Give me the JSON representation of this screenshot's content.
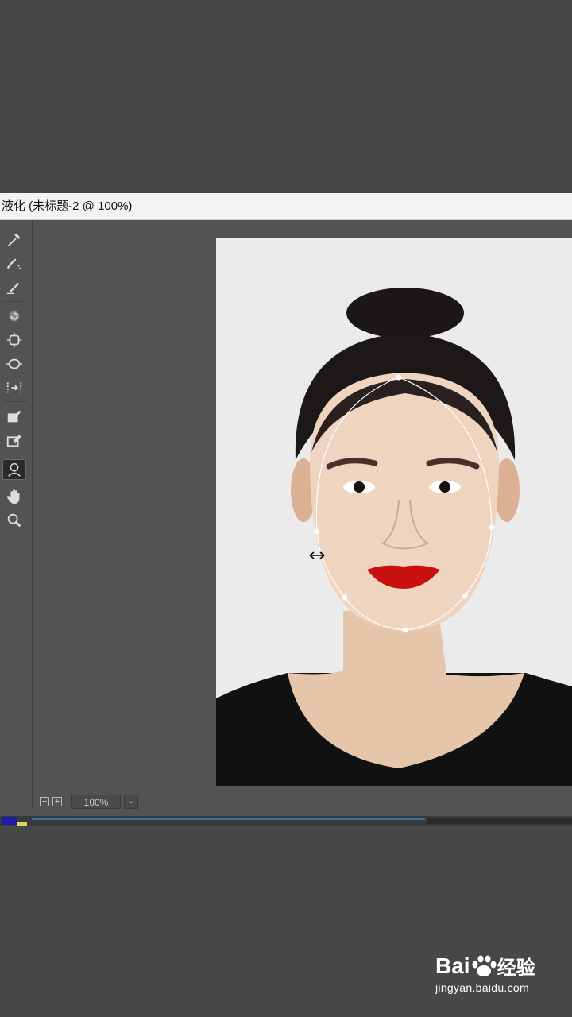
{
  "window": {
    "title": "液化 (未标题-2 @ 100%)"
  },
  "toolbar": {
    "tools": [
      {
        "name": "forward-warp-tool",
        "icon": "warp-icon"
      },
      {
        "name": "reconstruct-tool",
        "icon": "reconstruct-icon"
      },
      {
        "name": "smooth-tool",
        "icon": "smooth-icon"
      },
      {
        "name": "twirl-tool",
        "icon": "twirl-icon"
      },
      {
        "name": "pucker-tool",
        "icon": "pucker-icon"
      },
      {
        "name": "bloat-tool",
        "icon": "bloat-icon"
      },
      {
        "name": "push-left-tool",
        "icon": "push-left-icon"
      },
      {
        "name": "freeze-mask-tool",
        "icon": "freeze-mask-icon"
      },
      {
        "name": "thaw-mask-tool",
        "icon": "thaw-mask-icon"
      },
      {
        "name": "face-tool",
        "icon": "face-icon",
        "active": true
      },
      {
        "name": "hand-tool",
        "icon": "hand-icon"
      },
      {
        "name": "zoom-tool",
        "icon": "zoom-icon"
      }
    ]
  },
  "statusbar": {
    "zoom_out": "−",
    "zoom_in": "+",
    "zoom_value": "100%",
    "zoom_dropdown": "⌄"
  },
  "watermark": {
    "logo_text": "Bai",
    "logo_text2": "经验",
    "url": "jingyan.baidu.com"
  },
  "colors": {
    "app_bg": "#474747",
    "panel_bg": "#535353",
    "title_bg": "#f3f3f3",
    "lip_red": "#c8100e"
  }
}
